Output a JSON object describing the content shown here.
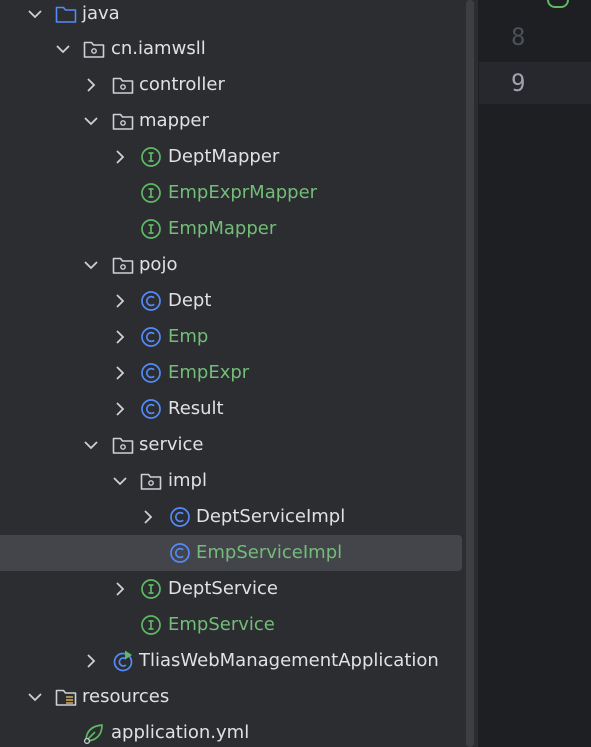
{
  "tree": {
    "java": "java",
    "pkg": "cn.iamwsll",
    "controller": "controller",
    "mapper": "mapper",
    "dept_mapper": "DeptMapper",
    "emp_expr_mapper": "EmpExprMapper",
    "emp_mapper": "EmpMapper",
    "pojo": "pojo",
    "dept": "Dept",
    "emp": "Emp",
    "emp_expr": "EmpExpr",
    "result": "Result",
    "service": "service",
    "impl": "impl",
    "dept_service_impl": "DeptServiceImpl",
    "emp_service_impl": "EmpServiceImpl",
    "dept_service": "DeptService",
    "emp_service": "EmpService",
    "app": "TliasWebManagementApplication",
    "resources": "resources",
    "application_yml": "application.yml"
  },
  "editor": {
    "line_8": "8",
    "line_9": "9"
  },
  "colors": {
    "panel_bg": "#2b2d30",
    "editor_bg": "#1e1f22",
    "text": "#dfe1e5",
    "vcs_added": "#73bd79",
    "interface_icon": "#5fb865",
    "class_icon": "#548af7",
    "selection": "#43454a"
  },
  "icons": {
    "chevron_expanded": "chevron-down-icon",
    "chevron_collapsed": "chevron-right-icon",
    "folder": "folder-icon",
    "package": "package-icon",
    "interface": "interface-icon",
    "class": "class-icon",
    "spring_boot_app": "spring-boot-class-icon",
    "resources_folder": "resources-folder-icon",
    "spring_config": "spring-config-icon"
  }
}
